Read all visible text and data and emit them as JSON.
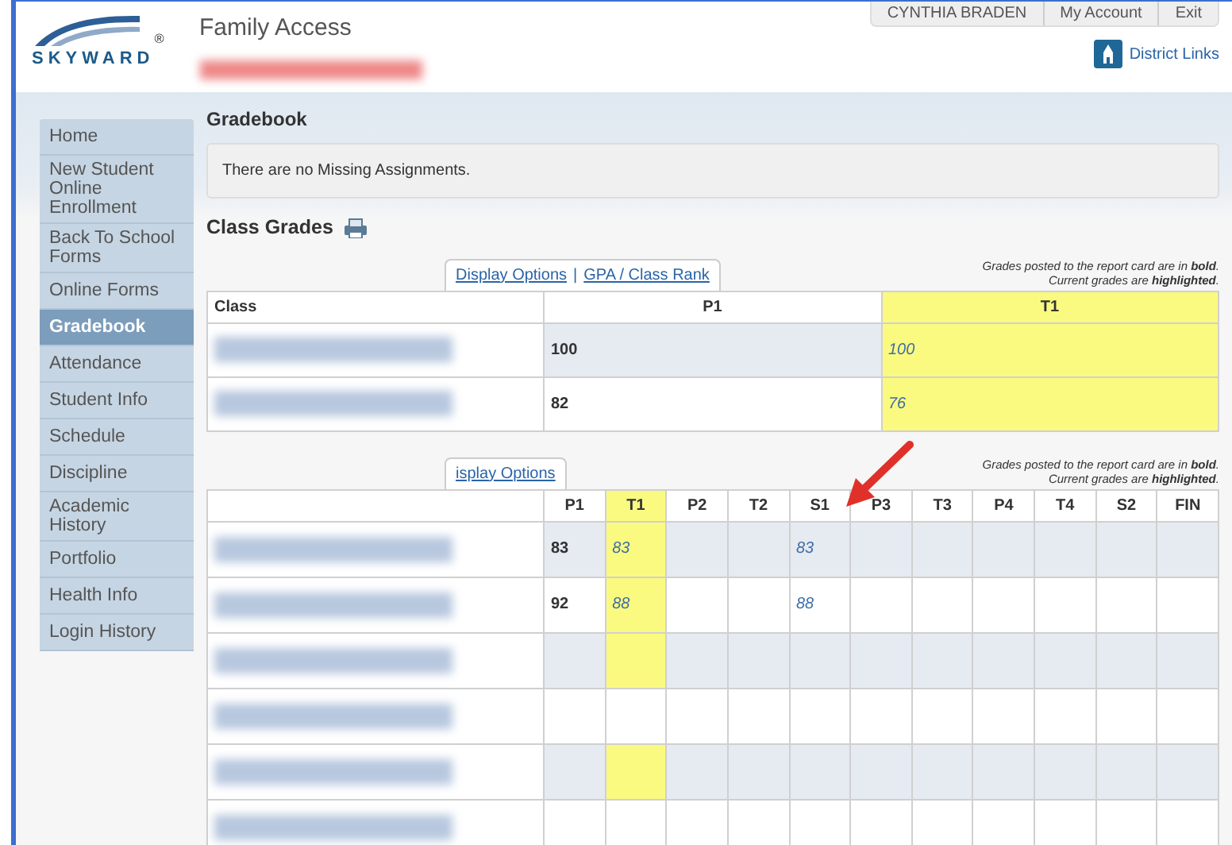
{
  "header": {
    "logo_text": "SKYWARD",
    "logo_mark": "®",
    "app_title": "Family Access",
    "user_menu": [
      "CYNTHIA BRADEN",
      "My Account",
      "Exit"
    ],
    "district_links": "District Links"
  },
  "sidebar": {
    "items": [
      {
        "label": "Home",
        "selected": false
      },
      {
        "label": "New Student Online Enrollment",
        "selected": false
      },
      {
        "label": "Back To School Forms",
        "selected": false
      },
      {
        "label": "Online Forms",
        "selected": false
      },
      {
        "label": "Gradebook",
        "selected": true
      },
      {
        "label": "Attendance",
        "selected": false
      },
      {
        "label": "Student Info",
        "selected": false
      },
      {
        "label": "Schedule",
        "selected": false
      },
      {
        "label": "Discipline",
        "selected": false
      },
      {
        "label": "Academic History",
        "selected": false
      },
      {
        "label": "Portfolio",
        "selected": false
      },
      {
        "label": "Health Info",
        "selected": false
      },
      {
        "label": "Login History",
        "selected": false
      }
    ]
  },
  "page_title": "Gradebook",
  "missing_notice": "There are no Missing Assignments.",
  "section_title": "Class Grades",
  "grade_tables": [
    {
      "links": [
        "Display Options",
        "GPA / Class Rank"
      ],
      "separator": "|",
      "legend": [
        "Grades posted to the report card are in **bold**.",
        "Current grades are **highlighted**."
      ],
      "class_header": "Class",
      "columns": [
        {
          "label": "P1",
          "highlighted": false
        },
        {
          "label": "T1",
          "highlighted": true
        }
      ],
      "rows": [
        {
          "cells": [
            {
              "text": "100",
              "posted": true,
              "highlighted": false
            },
            {
              "text": "100",
              "posted": false,
              "highlighted": true
            }
          ]
        },
        {
          "cells": [
            {
              "text": "82",
              "posted": true,
              "highlighted": false
            },
            {
              "text": "76",
              "posted": false,
              "highlighted": true
            }
          ]
        }
      ]
    },
    {
      "links": [
        "isplay Options"
      ],
      "legend": [
        "Grades posted to the report card are in **bold**.",
        "Current grades are **highlighted**."
      ],
      "columns": [
        {
          "label": "P1",
          "highlighted": false
        },
        {
          "label": "T1",
          "highlighted": true
        },
        {
          "label": "P2",
          "highlighted": false
        },
        {
          "label": "T2",
          "highlighted": false
        },
        {
          "label": "S1",
          "highlighted": false
        },
        {
          "label": "P3",
          "highlighted": false
        },
        {
          "label": "T3",
          "highlighted": false
        },
        {
          "label": "P4",
          "highlighted": false
        },
        {
          "label": "T4",
          "highlighted": false
        },
        {
          "label": "S2",
          "highlighted": false
        },
        {
          "label": "FIN",
          "highlighted": false
        }
      ],
      "rows": [
        {
          "cells": [
            {
              "text": "83",
              "posted": true,
              "highlighted": false
            },
            {
              "text": "83",
              "posted": false,
              "highlighted": true
            },
            {
              "highlighted": false
            },
            {
              "highlighted": false
            },
            {
              "text": "83",
              "posted": false,
              "highlighted": false
            },
            {
              "highlighted": false
            },
            {
              "highlighted": false
            },
            {
              "highlighted": false
            },
            {
              "highlighted": false
            },
            {
              "highlighted": false
            },
            {
              "highlighted": false
            }
          ]
        },
        {
          "cells": [
            {
              "text": "92",
              "posted": true,
              "highlighted": false
            },
            {
              "text": "88",
              "posted": false,
              "highlighted": true
            },
            {
              "highlighted": false
            },
            {
              "highlighted": false
            },
            {
              "text": "88",
              "posted": false,
              "highlighted": false
            },
            {
              "highlighted": false
            },
            {
              "highlighted": false
            },
            {
              "highlighted": false
            },
            {
              "highlighted": false
            },
            {
              "highlighted": false
            },
            {
              "highlighted": false
            }
          ]
        },
        {
          "cells": [
            {
              "highlighted": false
            },
            {
              "highlighted": true
            },
            {
              "highlighted": false
            },
            {
              "highlighted": false
            },
            {
              "highlighted": false
            },
            {
              "highlighted": false
            },
            {
              "highlighted": false
            },
            {
              "highlighted": false
            },
            {
              "highlighted": false
            },
            {
              "highlighted": false
            },
            {
              "highlighted": false
            }
          ]
        },
        {
          "cells": [
            {
              "highlighted": false
            },
            {
              "highlighted": false
            },
            {
              "highlighted": false
            },
            {
              "highlighted": false
            },
            {
              "highlighted": false
            },
            {
              "highlighted": false
            },
            {
              "highlighted": false
            },
            {
              "highlighted": false
            },
            {
              "highlighted": false
            },
            {
              "highlighted": false
            },
            {
              "highlighted": false
            }
          ]
        },
        {
          "cells": [
            {
              "highlighted": false
            },
            {
              "highlighted": true
            },
            {
              "highlighted": false
            },
            {
              "highlighted": false
            },
            {
              "highlighted": false
            },
            {
              "highlighted": false
            },
            {
              "highlighted": false
            },
            {
              "highlighted": false
            },
            {
              "highlighted": false
            },
            {
              "highlighted": false
            },
            {
              "highlighted": false
            }
          ]
        },
        {
          "cells": [
            {
              "highlighted": false
            },
            {
              "highlighted": false
            },
            {
              "highlighted": false
            },
            {
              "highlighted": false
            },
            {
              "highlighted": false
            },
            {
              "highlighted": false
            },
            {
              "highlighted": false
            },
            {
              "highlighted": false
            },
            {
              "highlighted": false
            },
            {
              "highlighted": false
            },
            {
              "highlighted": false
            }
          ]
        }
      ]
    }
  ]
}
